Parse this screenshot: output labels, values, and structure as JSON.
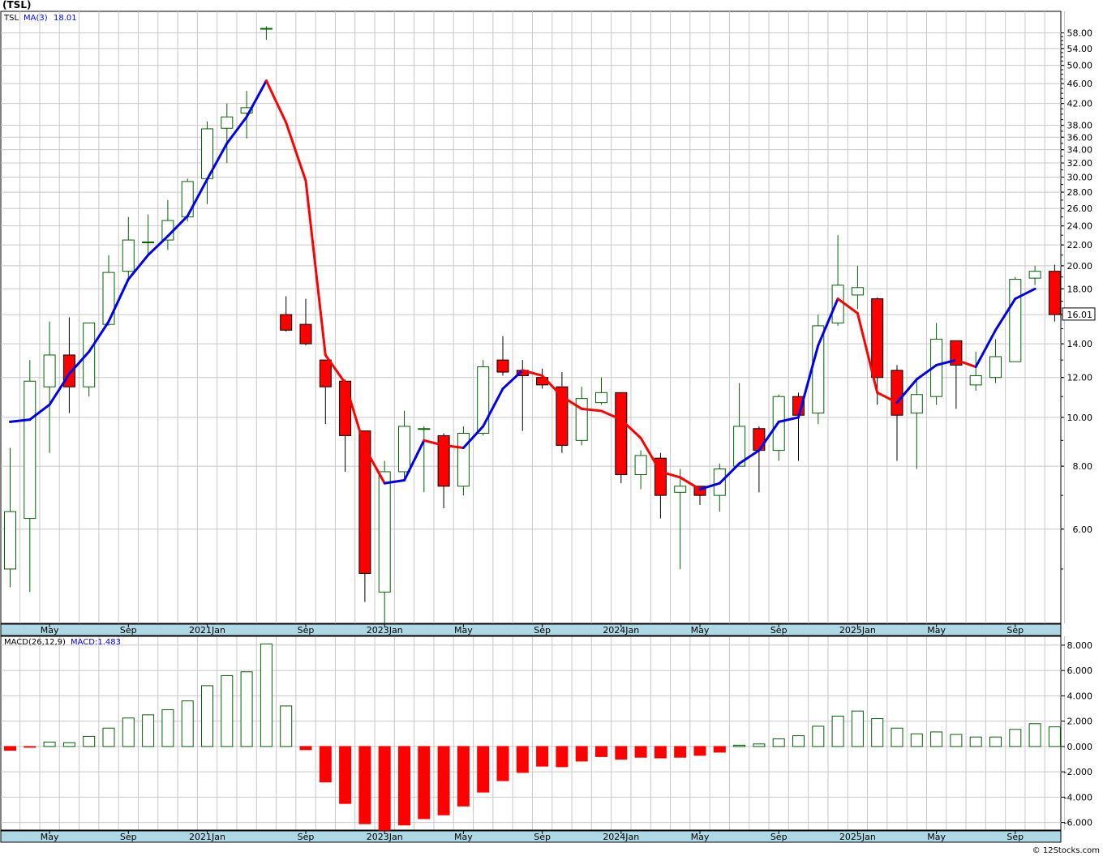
{
  "title": "(TSL)",
  "credit": "© 12Stocks.com",
  "colors": {
    "up": "#006400",
    "down": "#ff0000",
    "ma_up": "#0000ee",
    "ma_down": "#ff0000",
    "grid": "#c8c8c8",
    "axis_band": "#add8e6",
    "macd_text": "#0000ff"
  },
  "chart_data": [
    {
      "type": "candlestick",
      "panel": "price",
      "ticker_label": "TSL",
      "ma_label": "MA(3)",
      "ma_value": "18.01",
      "last_price_label": "16.01",
      "y_scale": "log",
      "ylim": [
        3.9,
        64
      ],
      "y_ticks": [
        6.0,
        8.0,
        10.0,
        12.0,
        14.0,
        16.0,
        18.0,
        20.0,
        22.0,
        24.0,
        26.0,
        28.0,
        30.0,
        32.0,
        34.0,
        36.0,
        38.0,
        42.0,
        46.0,
        50.0,
        54.0,
        58.0
      ],
      "x_labels": [
        {
          "i": 2,
          "label": "May"
        },
        {
          "i": 6,
          "label": "Sep"
        },
        {
          "i": 10,
          "label": "2021Jan"
        },
        {
          "i": 15,
          "label": "Sep"
        },
        {
          "i": 19,
          "label": "2023Jan"
        },
        {
          "i": 23,
          "label": "May"
        },
        {
          "i": 27,
          "label": "Sep"
        },
        {
          "i": 31,
          "label": "2024Jan"
        },
        {
          "i": 35,
          "label": "May"
        },
        {
          "i": 39,
          "label": "Sep"
        },
        {
          "i": 43,
          "label": "2025Jan"
        },
        {
          "i": 47,
          "label": "May"
        },
        {
          "i": 51,
          "label": "Sep"
        }
      ],
      "candles": [
        {
          "o": 5.0,
          "h": 8.7,
          "l": 4.6,
          "c": 6.5
        },
        {
          "o": 6.3,
          "h": 13.0,
          "l": 4.5,
          "c": 11.8
        },
        {
          "o": 11.5,
          "h": 15.5,
          "l": 8.5,
          "c": 13.3
        },
        {
          "o": 13.3,
          "h": 15.8,
          "l": 10.2,
          "c": 11.5
        },
        {
          "o": 11.5,
          "h": 14.2,
          "l": 11.0,
          "c": 15.4
        },
        {
          "o": 15.3,
          "h": 21.0,
          "l": 15.2,
          "c": 19.4
        },
        {
          "o": 19.5,
          "h": 25.0,
          "l": 18.8,
          "c": 22.5
        },
        {
          "o": 22.3,
          "h": 25.3,
          "l": 21.0,
          "c": 22.3
        },
        {
          "o": 22.5,
          "h": 27.0,
          "l": 21.5,
          "c": 24.6
        },
        {
          "o": 25.0,
          "h": 29.8,
          "l": 24.5,
          "c": 29.4
        },
        {
          "o": 29.8,
          "h": 38.7,
          "l": 26.5,
          "c": 37.4
        },
        {
          "o": 37.5,
          "h": 42.0,
          "l": 32.0,
          "c": 39.5
        },
        {
          "o": 40.2,
          "h": 44.5,
          "l": 35.8,
          "c": 41.2
        },
        {
          "o": 59.2,
          "h": 59.8,
          "l": 56.2,
          "c": 59.2
        },
        {
          "o": 16.0,
          "h": 17.4,
          "l": 14.8,
          "c": 14.9
        },
        {
          "o": 15.3,
          "h": 17.2,
          "l": 13.9,
          "c": 14.0
        },
        {
          "o": 13.0,
          "h": 13.0,
          "l": 9.7,
          "c": 11.5
        },
        {
          "o": 11.8,
          "h": 11.9,
          "l": 7.8,
          "c": 9.2
        },
        {
          "o": 9.4,
          "h": 9.4,
          "l": 4.3,
          "c": 4.9
        },
        {
          "o": 4.5,
          "h": 8.2,
          "l": 3.7,
          "c": 7.8
        },
        {
          "o": 7.8,
          "h": 10.3,
          "l": 7.6,
          "c": 9.6
        },
        {
          "o": 9.5,
          "h": 9.6,
          "l": 7.1,
          "c": 9.5
        },
        {
          "o": 9.2,
          "h": 9.3,
          "l": 6.6,
          "c": 7.3
        },
        {
          "o": 7.3,
          "h": 9.6,
          "l": 7.0,
          "c": 9.3
        },
        {
          "o": 9.3,
          "h": 13.0,
          "l": 9.2,
          "c": 12.6
        },
        {
          "o": 13.0,
          "h": 14.5,
          "l": 12.1,
          "c": 12.3
        },
        {
          "o": 12.4,
          "h": 13.0,
          "l": 9.4,
          "c": 12.1
        },
        {
          "o": 12.0,
          "h": 12.5,
          "l": 11.4,
          "c": 11.6
        },
        {
          "o": 11.5,
          "h": 12.3,
          "l": 8.5,
          "c": 8.8
        },
        {
          "o": 9.0,
          "h": 11.5,
          "l": 8.8,
          "c": 10.9
        },
        {
          "o": 10.7,
          "h": 12.0,
          "l": 10.6,
          "c": 11.2
        },
        {
          "o": 11.2,
          "h": 11.2,
          "l": 7.4,
          "c": 7.7
        },
        {
          "o": 7.7,
          "h": 8.6,
          "l": 7.2,
          "c": 8.4
        },
        {
          "o": 8.3,
          "h": 8.5,
          "l": 6.3,
          "c": 7.0
        },
        {
          "o": 7.1,
          "h": 7.9,
          "l": 5.0,
          "c": 7.3
        },
        {
          "o": 7.3,
          "h": 7.3,
          "l": 6.7,
          "c": 7.0
        },
        {
          "o": 7.0,
          "h": 8.1,
          "l": 6.5,
          "c": 7.9
        },
        {
          "o": 8.0,
          "h": 11.7,
          "l": 8.0,
          "c": 9.6
        },
        {
          "o": 9.5,
          "h": 9.6,
          "l": 7.1,
          "c": 8.6
        },
        {
          "o": 8.6,
          "h": 11.1,
          "l": 8.2,
          "c": 11.0
        },
        {
          "o": 11.0,
          "h": 11.2,
          "l": 8.2,
          "c": 10.1
        },
        {
          "o": 10.2,
          "h": 16.0,
          "l": 9.7,
          "c": 15.2
        },
        {
          "o": 15.4,
          "h": 23.0,
          "l": 15.2,
          "c": 18.3
        },
        {
          "o": 17.5,
          "h": 20.0,
          "l": 16.4,
          "c": 18.1
        },
        {
          "o": 17.2,
          "h": 17.3,
          "l": 10.6,
          "c": 12.0
        },
        {
          "o": 12.4,
          "h": 12.7,
          "l": 8.2,
          "c": 10.1
        },
        {
          "o": 10.2,
          "h": 11.8,
          "l": 7.9,
          "c": 11.1
        },
        {
          "o": 11.0,
          "h": 15.4,
          "l": 10.6,
          "c": 14.3
        },
        {
          "o": 14.2,
          "h": 14.1,
          "l": 10.4,
          "c": 12.7
        },
        {
          "o": 11.6,
          "h": 13.5,
          "l": 11.3,
          "c": 12.1
        },
        {
          "o": 12.0,
          "h": 14.3,
          "l": 11.7,
          "c": 13.2
        },
        {
          "o": 12.9,
          "h": 19.0,
          "l": 12.9,
          "c": 18.8
        },
        {
          "o": 18.9,
          "h": 20.0,
          "l": 18.3,
          "c": 19.5
        },
        {
          "o": 19.5,
          "h": 20.1,
          "l": 15.5,
          "c": 16.0
        }
      ],
      "ma": [
        9.8,
        9.9,
        10.6,
        12.2,
        13.5,
        15.5,
        18.8,
        21.0,
        22.9,
        25.1,
        29.7,
        35.0,
        39.5,
        46.6,
        38.5,
        29.5,
        13.3,
        11.7,
        8.7,
        7.4,
        7.5,
        9.0,
        8.8,
        8.7,
        9.6,
        11.4,
        12.4,
        12.1,
        11.0,
        10.4,
        10.3,
        9.9,
        9.1,
        7.8,
        7.6,
        7.2,
        7.4,
        8.1,
        8.6,
        9.8,
        10.0,
        13.9,
        17.2,
        16.1,
        11.2,
        10.7,
        11.9,
        12.7,
        13.0,
        12.6,
        14.9,
        17.2,
        18.0
      ]
    },
    {
      "type": "bar",
      "panel": "macd",
      "label": "MACD(26,12,9)",
      "value_label": "MACD:1.483",
      "ylim": [
        -6.6,
        8.7
      ],
      "y_ticks": [
        -6.0,
        -4.0,
        -2.0,
        0.0,
        2.0,
        4.0,
        6.0,
        8.0
      ],
      "y_tick_labels": [
        "-6.000",
        "-4.000",
        "-2.000",
        "0.000",
        "2.000",
        "4.000",
        "6.000",
        "8.000"
      ],
      "values": [
        -0.3,
        -0.05,
        0.35,
        0.3,
        0.8,
        1.45,
        2.25,
        2.5,
        2.9,
        3.6,
        4.8,
        5.6,
        5.9,
        8.1,
        3.2,
        -0.25,
        -2.8,
        -4.5,
        -6.1,
        -6.6,
        -6.2,
        -5.7,
        -5.4,
        -4.7,
        -3.6,
        -2.7,
        -2.05,
        -1.55,
        -1.6,
        -1.15,
        -0.8,
        -1.0,
        -0.85,
        -0.9,
        -0.85,
        -0.7,
        -0.45,
        0.1,
        0.2,
        0.6,
        0.85,
        1.6,
        2.4,
        2.8,
        2.2,
        1.45,
        1.0,
        1.15,
        0.95,
        0.75,
        0.75,
        1.35,
        1.8,
        1.55
      ]
    }
  ]
}
